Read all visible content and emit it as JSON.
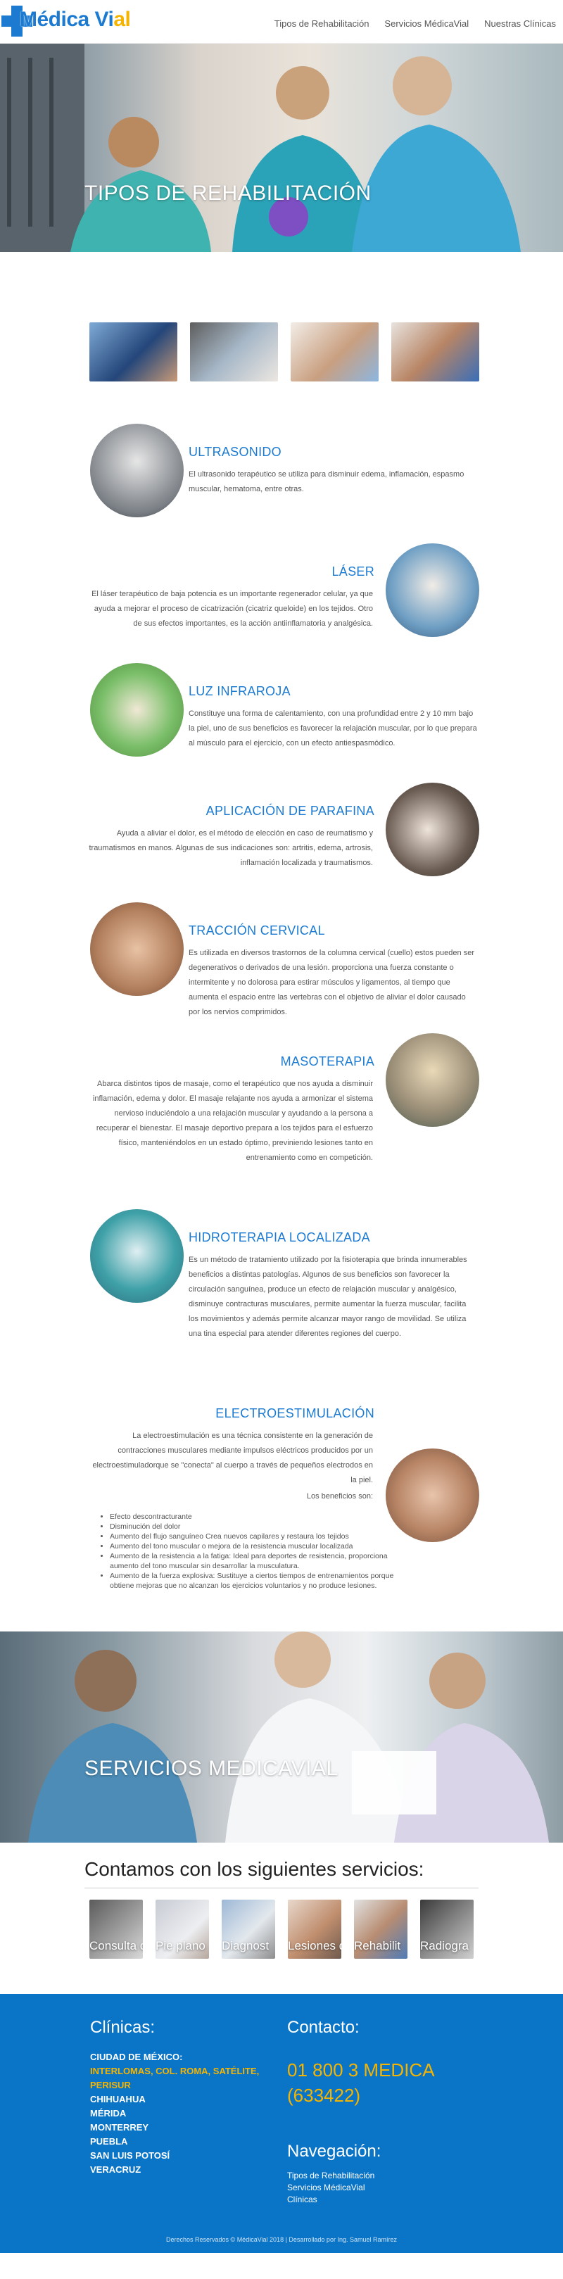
{
  "logo": {
    "part1": "M",
    "part2": "édica Vi",
    "part3": "al"
  },
  "nav": [
    "Tipos de Rehabilitación",
    "Servicios MédicaVial",
    "Nuestras Clínicas"
  ],
  "hero1": {
    "title": "TIPOS DE REHABILITACIÓN"
  },
  "thumbnails": [
    "thumb-1",
    "thumb-2",
    "thumb-3",
    "thumb-4"
  ],
  "treatments": [
    {
      "title": "ULTRASONIDO",
      "text": "El ultrasonido terapéutico se utiliza para disminuir edema, inflamación, espasmo muscular, hematoma, entre otras."
    },
    {
      "title": "LÁSER",
      "text": "El láser terapéutico de baja potencia es un importante regenerador celular, ya que ayuda a mejorar el proceso de cicatrización (cicatriz queloide) en los tejidos. Otro de sus efectos importantes, es la acción antiinflamatoria y analgésica."
    },
    {
      "title": "LUZ INFRAROJA",
      "text": "Constituye una forma de calentamiento, con una profundidad entre 2 y 10 mm bajo la piel, uno de sus beneficios es favorecer la relajación muscular, por lo que prepara al músculo para el ejercicio, con un efecto antiespasmódico."
    },
    {
      "title": "APLICACIÓN DE PARAFINA",
      "text": "Ayuda a aliviar el dolor, es el método de elección en caso de reumatismo y traumatismos en manos. Algunas de sus indicaciones son: artritis, edema, artrosis, inflamación localizada y traumatismos."
    },
    {
      "title": "TRACCIÓN CERVICAL",
      "text": "Es utilizada en diversos trastornos de la columna cervical (cuello) estos pueden ser degenerativos o derivados de una lesión. proporciona una fuerza constante o intermitente y no dolorosa para estirar músculos y ligamentos, al tiempo que aumenta el espacio entre las vertebras con el objetivo de aliviar el dolor causado por los nervios comprimidos."
    },
    {
      "title": "MASOTERAPIA",
      "text": "Abarca distintos tipos de masaje, como el terapéutico que nos ayuda a disminuir inflamación, edema y dolor. El masaje relajante nos ayuda a armonizar el sistema nervioso induciéndolo a una relajación muscular y ayudando a la persona a recuperar el bienestar. El masaje deportivo prepara a los tejidos para el esfuerzo físico, manteniéndolos en un estado óptimo, previniendo lesiones tanto en entrenamiento como en competición."
    },
    {
      "title": "HIDROTERAPIA LOCALIZADA",
      "text": "Es un método de tratamiento utilizado por la fisioterapia que brinda innumerables beneficios a distintas patologías. Algunos de sus beneficios son favorecer la circulación sanguínea, produce un efecto de relajación muscular y analgésico, disminuye contracturas musculares, permite aumentar la fuerza muscular, facilita los movimientos y además permite alcanzar mayor rango de movilidad. Se utiliza una tina especial para atender diferentes regiones del cuerpo."
    },
    {
      "title": "ELECTROESTIMULACIÓN",
      "text": "La electroestimulación es una técnica consistente en la generación de contracciones musculares mediante impulsos eléctricos producidos por un electroestimuladorque se \"conecta\" al cuerpo a través de pequeños electrodos en la piel.",
      "subtitle": "Los beneficios son:"
    }
  ],
  "electro_benefits": [
    "Efecto descontracturante",
    "Disminución del dolor",
    "Aumento del flujo sanguíneo Crea nuevos capilares y restaura los tejidos",
    "Aumento del tono muscular o mejora de la resistencia muscular localizada",
    "Aumento de la resistencia a la fatiga: Ideal para deportes de resistencia, proporciona aumento del tono muscular sin desarrollar la musculatura.",
    "Aumento de la fuerza explosiva: Sustituye a ciertos tiempos de entrenamientos porque obtiene mejoras que no alcanzan los ejercicios voluntarios y no produce lesiones."
  ],
  "hero2": {
    "title": "SERVICIOS MEDICAVIAL"
  },
  "services": {
    "title": "Contamos con los siguientes servicios:",
    "items": [
      "Consulta ortopedi",
      "Pie plano",
      "Diagnost",
      "Lesiones deportiva",
      "Rehabilit",
      "Radiogra"
    ]
  },
  "footer": {
    "clinicas_title": "Clínicas:",
    "clinicas": [
      "CIUDAD DE MÉXICO:",
      "INTERLOMAS, COL. ROMA, SATÉLITE, PERISUR",
      "CHIHUAHUA",
      "MÉRIDA",
      "MONTERREY",
      "PUEBLA",
      "SAN LUIS POTOSÍ",
      "VERACRUZ"
    ],
    "contacto_title": "Contacto:",
    "phone_line1": "01 800 3 MEDICA",
    "phone_line2": "(633422)",
    "nav_title": "Navegación:",
    "nav_links": [
      "Tipos de Rehabilitación",
      "Servicios MédicaVial",
      "Clínicas"
    ],
    "copyright": "Derechos Reservados © MédicaVial 2018 | Desarrollado por Ing. Samuel Ramírez"
  },
  "colors": {
    "brand_blue": "#1c7bd1",
    "brand_yellow": "#f5b400",
    "footer_blue": "#0a74c6"
  }
}
